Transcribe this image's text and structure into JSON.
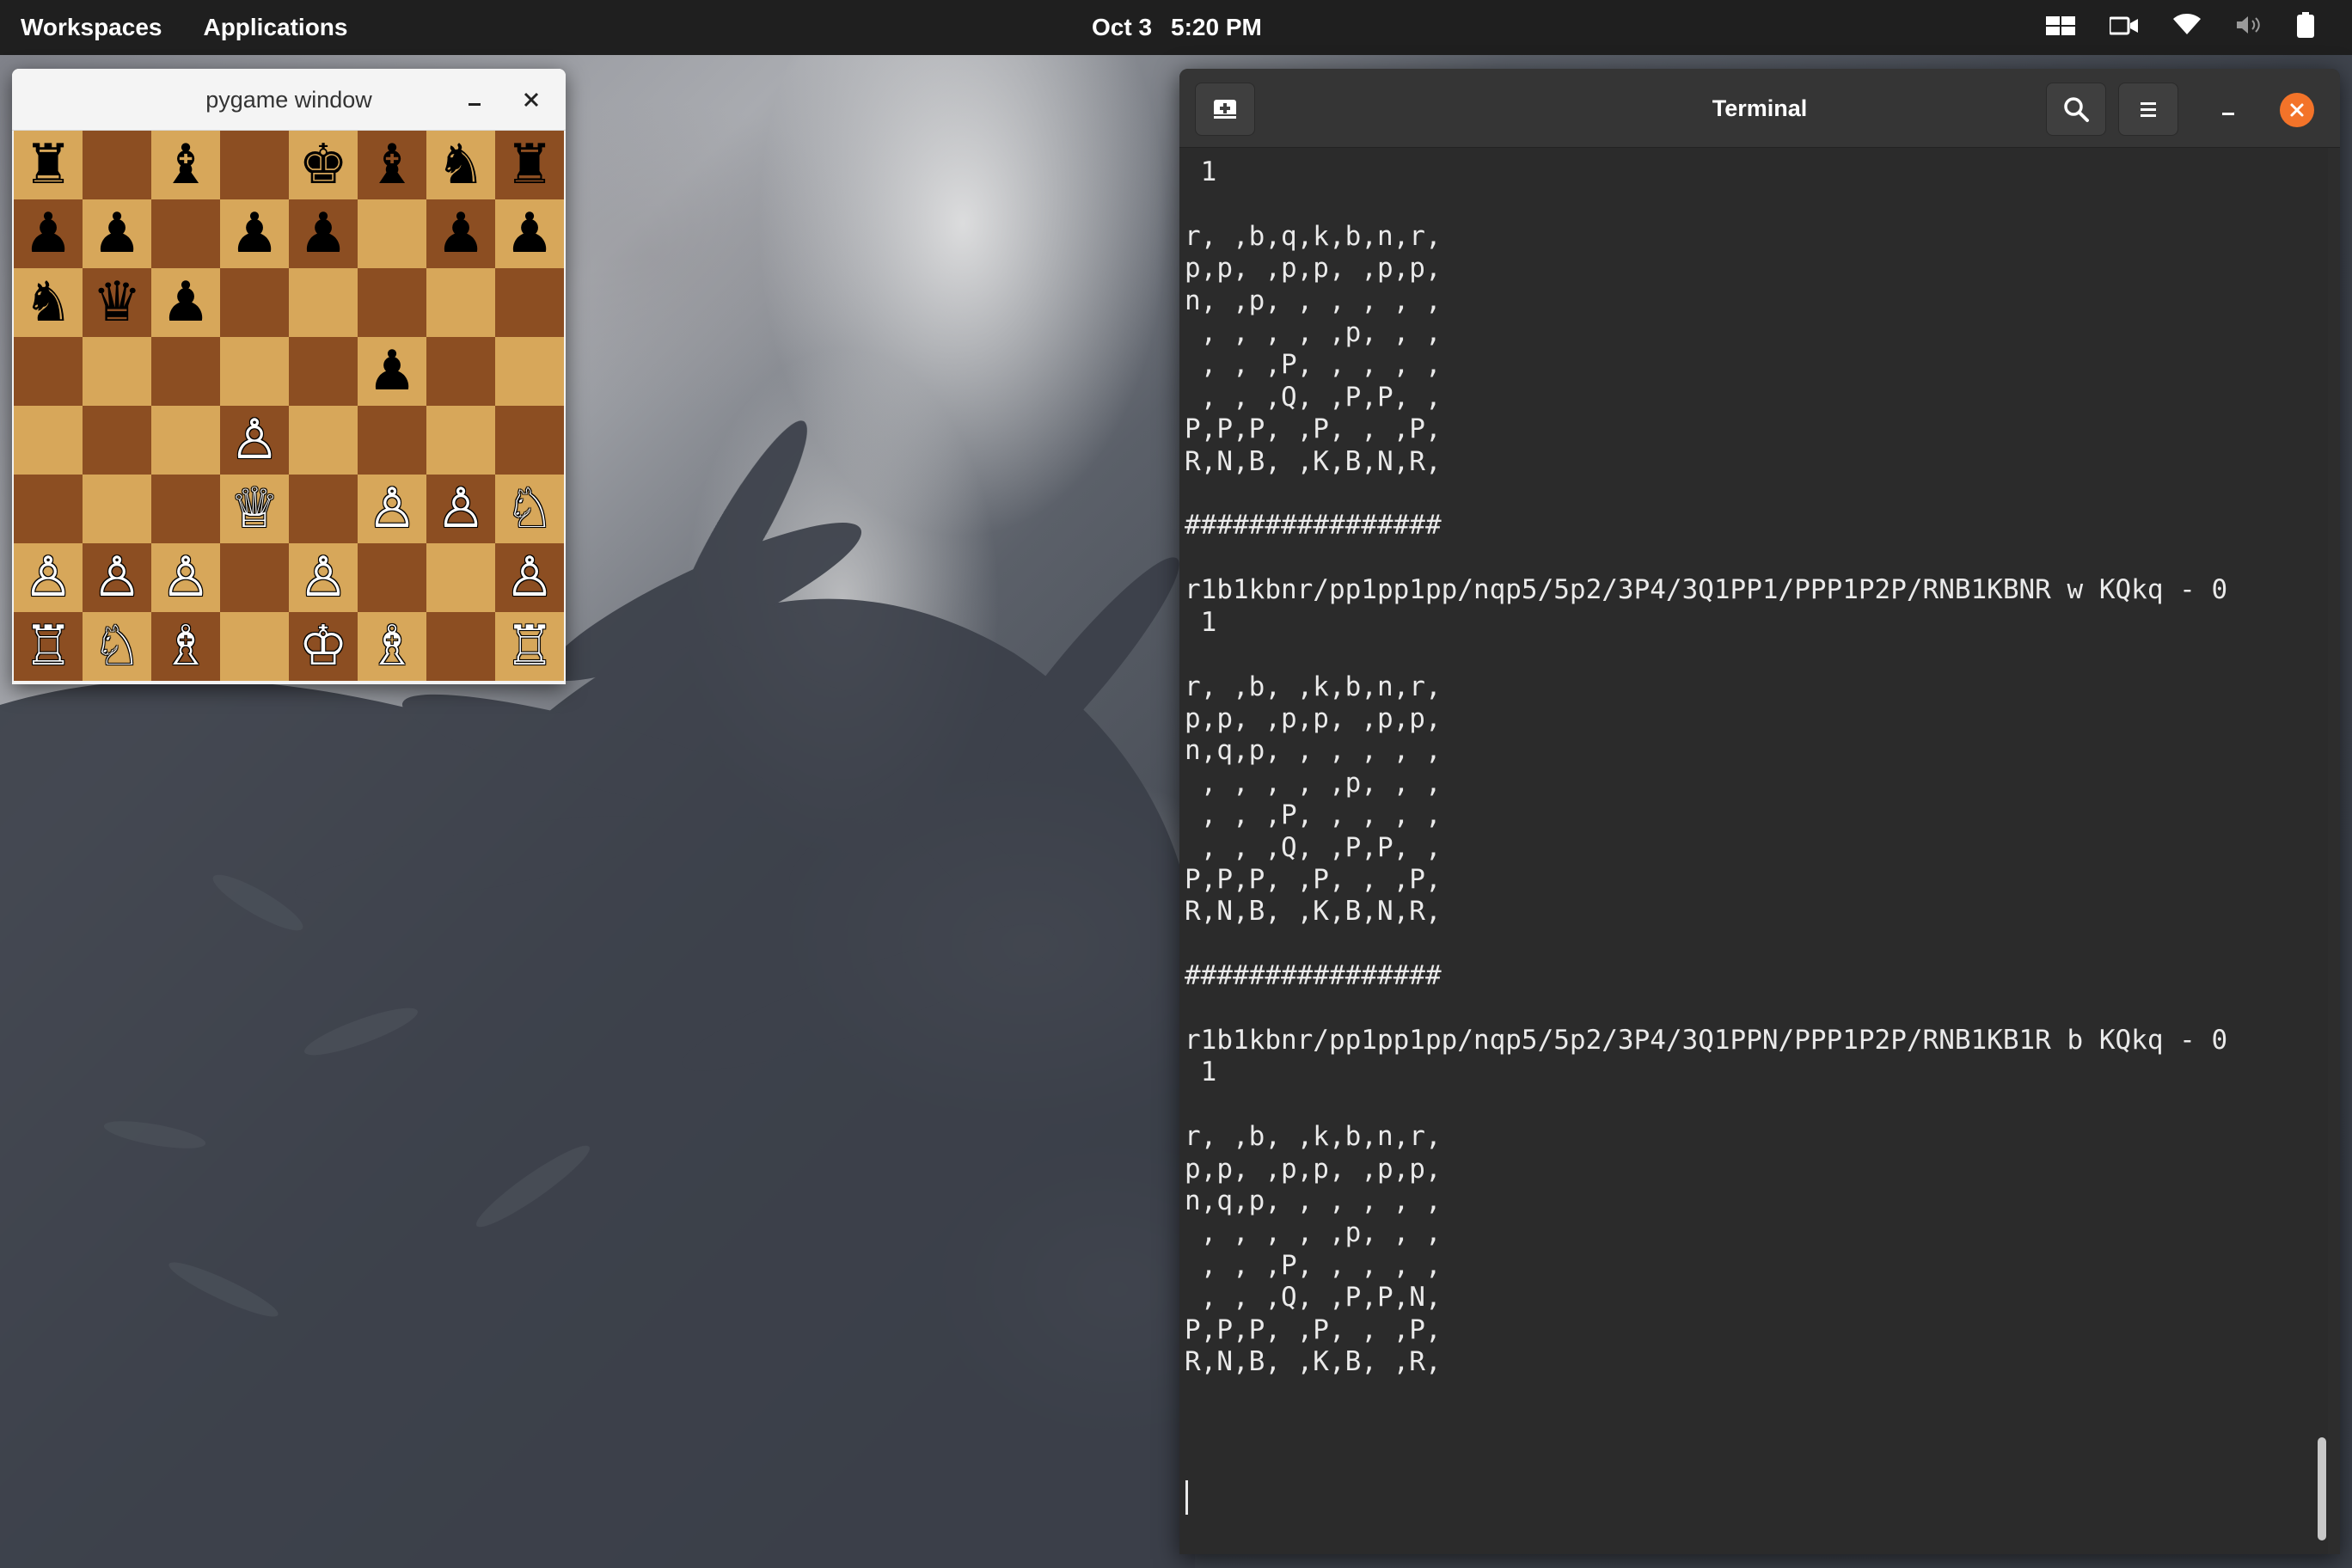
{
  "top_panel": {
    "workspaces": "Workspaces",
    "applications": "Applications",
    "date": "Oct 3",
    "time": "5:20 PM",
    "indicators": [
      "multitasking-icon",
      "screen-record-icon",
      "wifi-icon",
      "volume-muted-icon",
      "battery-icon"
    ]
  },
  "pygame_window": {
    "title": "pygame window",
    "board": [
      [
        "♜",
        "",
        "♝",
        "",
        "♚",
        "♝",
        "♞",
        "♜"
      ],
      [
        "♟",
        "♟",
        "",
        "♟",
        "♟",
        "",
        "♟",
        "♟"
      ],
      [
        "♞",
        "♛",
        "♟",
        "",
        "",
        "",
        "",
        ""
      ],
      [
        "",
        "",
        "",
        "",
        "",
        "♟",
        "",
        ""
      ],
      [
        "",
        "",
        "",
        "♙",
        "",
        "",
        "",
        ""
      ],
      [
        "",
        "",
        "",
        "♕",
        "",
        "♙",
        "♙",
        "♘"
      ],
      [
        "♙",
        "♙",
        "♙",
        "",
        "♙",
        "",
        "",
        "♙"
      ],
      [
        "♖",
        "♘",
        "♗",
        "",
        "♔",
        "♗",
        "",
        "♖"
      ]
    ],
    "colors": {
      "light_square": "#d7a75a",
      "dark_square": "#8c4e22"
    }
  },
  "terminal": {
    "title": "Terminal",
    "lines": [
      " 1",
      "",
      "r, ,b,q,k,b,n,r,",
      "p,p, ,p,p, ,p,p,",
      "n, ,p, , , , , ,",
      " , , , , ,p, , ,",
      " , , ,P, , , , ,",
      " , , ,Q, ,P,P, ,",
      "P,P,P, ,P, , ,P,",
      "R,N,B, ,K,B,N,R,",
      "",
      "################",
      "",
      "r1b1kbnr/pp1pp1pp/nqp5/5p2/3P4/3Q1PP1/PPP1P2P/RNB1KBNR w KQkq - 0",
      " 1",
      "",
      "r, ,b, ,k,b,n,r,",
      "p,p, ,p,p, ,p,p,",
      "n,q,p, , , , , ,",
      " , , , , ,p, , ,",
      " , , ,P, , , , ,",
      " , , ,Q, ,P,P, ,",
      "P,P,P, ,P, , ,P,",
      "R,N,B, ,K,B,N,R,",
      "",
      "################",
      "",
      "r1b1kbnr/pp1pp1pp/nqp5/5p2/3P4/3Q1PPN/PPP1P2P/RNB1KB1R b KQkq - 0",
      " 1",
      "",
      "r, ,b, ,k,b,n,r,",
      "p,p, ,p,p, ,p,p,",
      "n,q,p, , , , , ,",
      " , , , , ,p, , ,",
      " , , ,P, , , , ,",
      " , , ,Q, ,P,P,N,",
      "P,P,P, ,P, , ,P,",
      "R,N,B, ,K,B, ,R,"
    ]
  },
  "colors": {
    "panel_bg": "#1f1f1f",
    "terminal_bg": "#2b2b2b",
    "terminal_text": "#eaeaea",
    "close_accent": "#f37329"
  }
}
